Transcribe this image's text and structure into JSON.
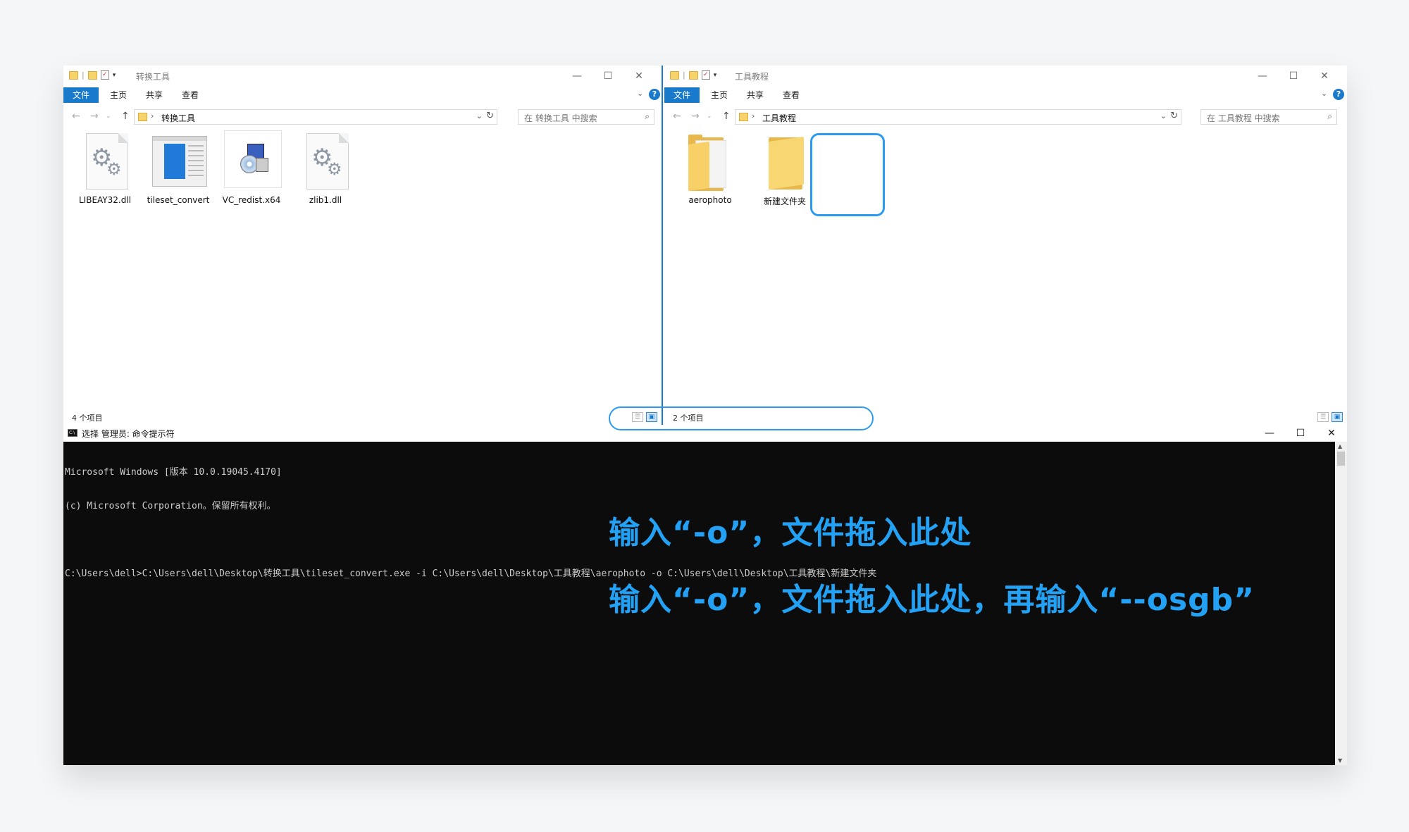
{
  "left_explorer": {
    "title": "转换工具",
    "ribbon": {
      "file": "文件",
      "home": "主页",
      "share": "共享",
      "view": "查看"
    },
    "address_path": "转换工具",
    "search_placeholder": "在 转换工具 中搜索",
    "files": [
      {
        "name": "LIBEAY32.dll",
        "icon": "dll-gear-icon"
      },
      {
        "name": "tileset_convert",
        "icon": "app-window-icon"
      },
      {
        "name": "VC_redist.x64",
        "icon": "installer-icon"
      },
      {
        "name": "zlib1.dll",
        "icon": "dll-gear-icon"
      }
    ],
    "status": "4 个项目"
  },
  "right_explorer": {
    "title": "工具教程",
    "ribbon": {
      "file": "文件",
      "home": "主页",
      "share": "共享",
      "view": "查看"
    },
    "address_path": "工具教程",
    "search_placeholder": "在 工具教程 中搜索",
    "files": [
      {
        "name": "aerophoto",
        "icon": "folder-icon"
      },
      {
        "name": "新建文件夹",
        "icon": "folder-icon",
        "selected": true
      }
    ],
    "status": "2 个项目"
  },
  "cmd": {
    "title": "选择 管理员: 命令提示符",
    "lines": [
      "Microsoft Windows [版本 10.0.19045.4170]",
      "(c) Microsoft Corporation。保留所有权利。",
      "",
      "C:\\Users\\dell>C:\\Users\\dell\\Desktop\\转换工具\\tileset_convert.exe -i C:\\Users\\dell\\Desktop\\工具教程\\aerophoto -o C:\\Users\\dell\\Desktop\\工具教程\\新建文件夹"
    ]
  },
  "annotations": {
    "line1": "输入“-o”，文件拖入此处",
    "line2": "输入“-o”，文件拖入此处，再输入“--osgb”"
  },
  "window_controls": {
    "minimize": "—",
    "maximize": "☐",
    "close": "✕"
  },
  "colors": {
    "accent": "#1979ca",
    "annotation": "#23a2f5",
    "console_bg": "#0c0c0c"
  }
}
